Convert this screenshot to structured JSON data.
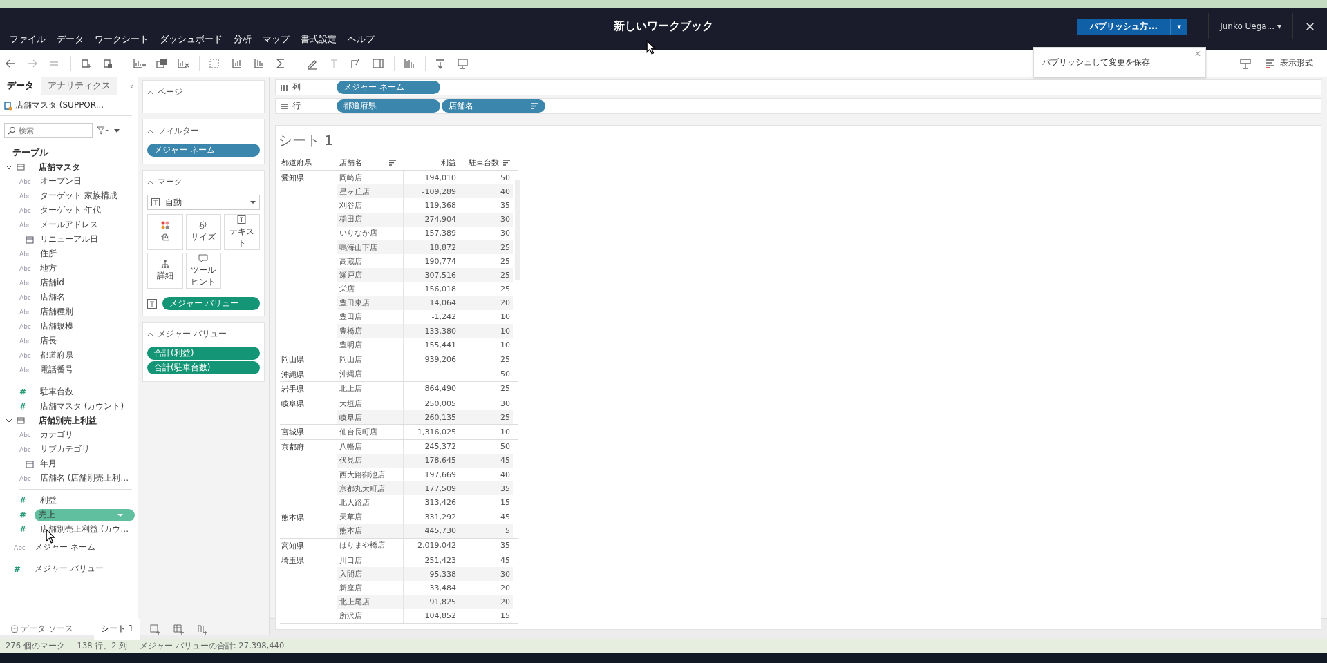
{
  "window": {
    "title": "新しいワークブック"
  },
  "menu": [
    "ファイル",
    "データ",
    "ワークシート",
    "ダッシュボード",
    "分析",
    "マップ",
    "書式設定",
    "ヘルプ"
  ],
  "publish": {
    "label": "パブリッシュ方...",
    "caret": "▾"
  },
  "user": {
    "name": "Junko Uega...",
    "caret": "▾"
  },
  "close": "✕",
  "tooltip": {
    "text": "パブリッシュして変更を保存",
    "close": "✕"
  },
  "toolbar_right": {
    "format_label": "表示形式"
  },
  "side_tabs": [
    {
      "label": "データ",
      "selected": true
    },
    {
      "label": "アナリティクス",
      "selected": false
    }
  ],
  "collapse": "‹",
  "datasource": "店舗マスタ (SUPPOR...",
  "search": {
    "placeholder": "検索"
  },
  "tables_heading": "テーブル",
  "tables": [
    {
      "name": "店舗マスタ",
      "expanded": true,
      "fields": [
        {
          "kind": "string",
          "type_label": "Abc",
          "label": "オープン日",
          "selected": false
        },
        {
          "kind": "string",
          "type_label": "Abc",
          "label": "ターゲット 家族構成",
          "selected": false
        },
        {
          "kind": "string",
          "type_label": "Abc",
          "label": "ターゲット 年代",
          "selected": false
        },
        {
          "kind": "string",
          "type_label": "Abc",
          "label": "メールアドレス",
          "selected": false
        },
        {
          "kind": "date",
          "label": "リニューアル日",
          "selected": false
        },
        {
          "kind": "string",
          "type_label": "Abc",
          "label": "住所",
          "selected": false
        },
        {
          "kind": "string",
          "type_label": "Abc",
          "label": "地方",
          "selected": false
        },
        {
          "kind": "string",
          "type_label": "Abc",
          "label": "店舗id",
          "selected": false
        },
        {
          "kind": "string",
          "type_label": "Abc",
          "label": "店舗名",
          "selected": false
        },
        {
          "kind": "string",
          "type_label": "Abc",
          "label": "店舗種別",
          "selected": false
        },
        {
          "kind": "string",
          "type_label": "Abc",
          "label": "店舗規模",
          "selected": false
        },
        {
          "kind": "string",
          "type_label": "Abc",
          "label": "店長",
          "selected": false
        },
        {
          "kind": "string",
          "type_label": "Abc",
          "label": "都道府県",
          "selected": false
        },
        {
          "kind": "string",
          "type_label": "Abc",
          "label": "電話番号",
          "selected": false
        },
        {
          "kind": "divider"
        },
        {
          "kind": "number",
          "type_label": "#",
          "label": "駐車台数",
          "selected": false
        },
        {
          "kind": "number",
          "type_label": "#",
          "label": "店舗マスタ (カウント)",
          "selected": false
        }
      ]
    },
    {
      "name": "店舗別売上利益",
      "expanded": true,
      "fields": [
        {
          "kind": "string",
          "type_label": "Abc",
          "label": "カテゴリ",
          "selected": false
        },
        {
          "kind": "string",
          "type_label": "Abc",
          "label": "サブカテゴリ",
          "selected": false
        },
        {
          "kind": "date",
          "label": "年月",
          "selected": false
        },
        {
          "kind": "string",
          "type_label": "Abc",
          "label": "店舗名 (店舗別売上利...",
          "selected": false
        },
        {
          "kind": "divider"
        },
        {
          "kind": "number",
          "type_label": "#",
          "label": "利益",
          "selected": false
        },
        {
          "kind": "number",
          "type_label": "#",
          "label": "売上",
          "selected": true
        },
        {
          "kind": "number",
          "type_label": "#",
          "label": "店舗別売上利益 (カウ...",
          "selected": false
        }
      ]
    }
  ],
  "extra_fields": [
    {
      "kind": "string",
      "type_label": "Abc",
      "label": "メジャー ネーム"
    },
    {
      "kind": "number",
      "type_label": "#",
      "label": "メジャー バリュー"
    }
  ],
  "cards": {
    "pages": {
      "title": "ページ"
    },
    "filters": {
      "title": "フィルター",
      "pills": [
        {
          "kind": "dimension",
          "label": "メジャー ネーム"
        }
      ]
    },
    "marks": {
      "title": "マーク",
      "mark_type": "自動",
      "buttons": [
        {
          "kind": "color",
          "label": "色"
        },
        {
          "kind": "size",
          "label": "サイズ"
        },
        {
          "kind": "text",
          "label": "テキスト"
        },
        {
          "kind": "detail",
          "label": "詳細"
        },
        {
          "kind": "tooltip",
          "label": "ツールヒント"
        }
      ],
      "pills": [
        {
          "kind": "measure",
          "label": "メジャー バリュー"
        }
      ]
    },
    "measure_values": {
      "title": "メジャー バリュー",
      "pills": [
        {
          "kind": "measure",
          "label": "合計(利益)"
        },
        {
          "kind": "measure",
          "label": "合計(駐車台数)"
        }
      ]
    }
  },
  "shelves": [
    {
      "kind": "columns",
      "label": "列",
      "pills": [
        {
          "kind": "dimension",
          "label": "メジャー ネーム",
          "sorted": false
        }
      ]
    },
    {
      "kind": "rows",
      "label": "行",
      "pills": [
        {
          "kind": "dimension",
          "label": "都道府県",
          "sorted": false
        },
        {
          "kind": "dimension",
          "label": "店舗名",
          "sorted": true
        }
      ]
    }
  ],
  "sheet": {
    "title": "シート 1",
    "columns": [
      {
        "label": "都道府県",
        "sorted": false
      },
      {
        "label": "店舗名",
        "sorted": true
      },
      {
        "label": "利益",
        "sorted": false
      },
      {
        "label": "駐車台数",
        "sorted": true
      }
    ],
    "groups": [
      {
        "prefecture": "愛知県",
        "rows": [
          {
            "store": "岡崎店",
            "profit": "194,010",
            "parking": "50"
          },
          {
            "store": "星ヶ丘店",
            "profit": "-109,289",
            "parking": "40"
          },
          {
            "store": "刈谷店",
            "profit": "119,368",
            "parking": "35"
          },
          {
            "store": "稲田店",
            "profit": "274,904",
            "parking": "30"
          },
          {
            "store": "いりなか店",
            "profit": "157,389",
            "parking": "30"
          },
          {
            "store": "鳴海山下店",
            "profit": "18,872",
            "parking": "25"
          },
          {
            "store": "高蔵店",
            "profit": "190,774",
            "parking": "25"
          },
          {
            "store": "瀬戸店",
            "profit": "307,516",
            "parking": "25"
          },
          {
            "store": "栄店",
            "profit": "156,018",
            "parking": "25"
          },
          {
            "store": "豊田東店",
            "profit": "14,064",
            "parking": "20"
          },
          {
            "store": "豊田店",
            "profit": "-1,242",
            "parking": "10"
          },
          {
            "store": "豊橋店",
            "profit": "133,380",
            "parking": "10"
          },
          {
            "store": "豊明店",
            "profit": "155,441",
            "parking": "10"
          }
        ]
      },
      {
        "prefecture": "岡山県",
        "rows": [
          {
            "store": "岡山店",
            "profit": "939,206",
            "parking": "25"
          }
        ]
      },
      {
        "prefecture": "沖縄県",
        "rows": [
          {
            "store": "沖縄店",
            "parking": "50"
          }
        ]
      },
      {
        "prefecture": "岩手県",
        "rows": [
          {
            "store": "北上店",
            "profit": "864,490",
            "parking": "25"
          }
        ]
      },
      {
        "prefecture": "岐阜県",
        "rows": [
          {
            "store": "大垣店",
            "profit": "250,005",
            "parking": "30"
          },
          {
            "store": "岐阜店",
            "profit": "260,135",
            "parking": "25"
          }
        ]
      },
      {
        "prefecture": "宮城県",
        "rows": [
          {
            "store": "仙台長町店",
            "profit": "1,316,025",
            "parking": "10"
          }
        ]
      },
      {
        "prefecture": "京都府",
        "rows": [
          {
            "store": "八幡店",
            "profit": "245,372",
            "parking": "50"
          },
          {
            "store": "伏見店",
            "profit": "178,645",
            "parking": "45"
          },
          {
            "store": "西大路御池店",
            "profit": "197,669",
            "parking": "40"
          },
          {
            "store": "京都丸太町店",
            "profit": "177,509",
            "parking": "35"
          },
          {
            "store": "北大路店",
            "profit": "313,426",
            "parking": "15"
          }
        ]
      },
      {
        "prefecture": "熊本県",
        "rows": [
          {
            "store": "天草店",
            "profit": "331,292",
            "parking": "45"
          },
          {
            "store": "熊本店",
            "profit": "445,730",
            "parking": "5"
          }
        ]
      },
      {
        "prefecture": "高知県",
        "rows": [
          {
            "store": "はりまや橋店",
            "profit": "2,019,042",
            "parking": "35"
          }
        ]
      },
      {
        "prefecture": "埼玉県",
        "rows": [
          {
            "store": "川口店",
            "profit": "251,423",
            "parking": "45"
          },
          {
            "store": "入間店",
            "profit": "95,338",
            "parking": "30"
          },
          {
            "store": "新座店",
            "profit": "33,484",
            "parking": "20"
          },
          {
            "store": "北上尾店",
            "profit": "91,825",
            "parking": "20"
          },
          {
            "store": "所沢店",
            "profit": "104,852",
            "parking": "15"
          }
        ]
      }
    ]
  },
  "sheet_tabs": [
    {
      "kind": "datasource",
      "label": "データ ソース",
      "selected": false
    },
    {
      "kind": "sheet",
      "label": "シート 1",
      "selected": true
    }
  ],
  "status_bar": [
    "276 個のマーク",
    "138 行、2 列",
    "メジャー バリューの合計: 27,398,440"
  ]
}
